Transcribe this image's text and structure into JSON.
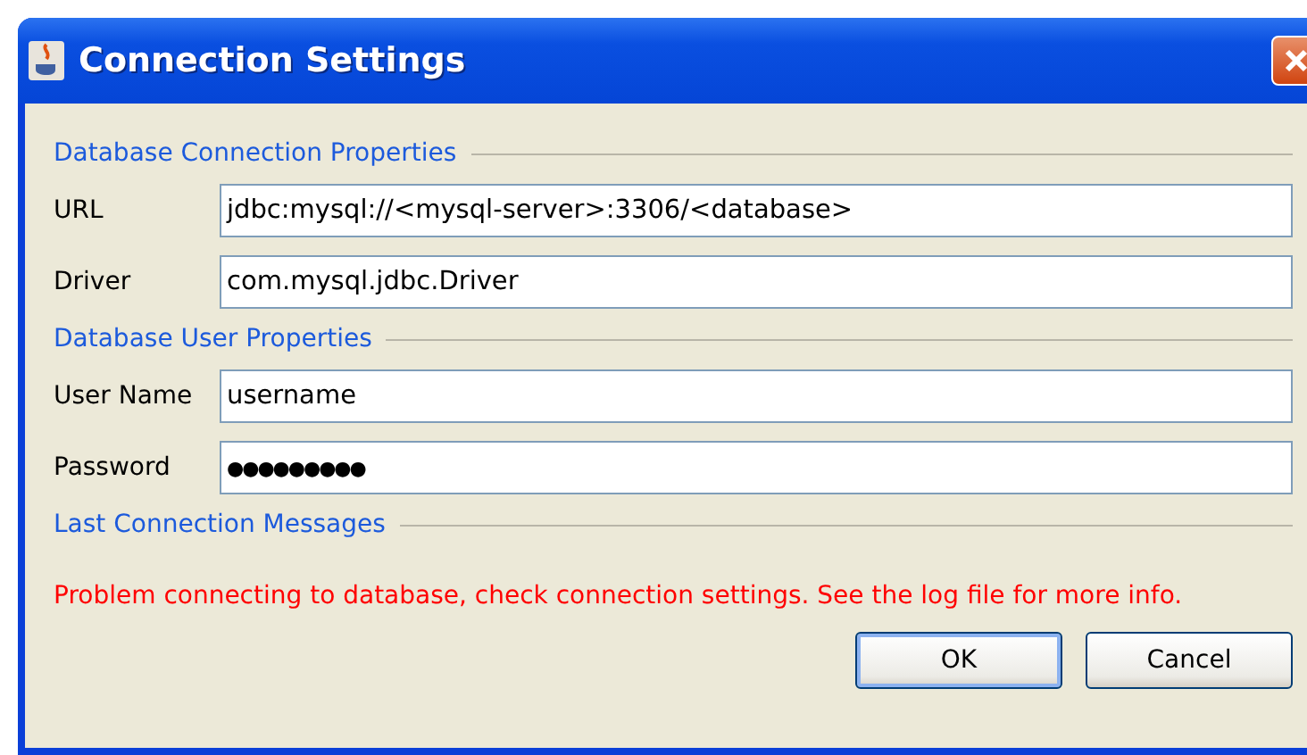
{
  "window": {
    "title": "Connection Settings"
  },
  "sections": [
    {
      "title": "Database Connection Properties",
      "fields": [
        {
          "label": "URL",
          "value": "jdbc:mysql://<mysql-server>:3306/<database>"
        },
        {
          "label": "Driver",
          "value": "com.mysql.jdbc.Driver"
        }
      ]
    },
    {
      "title": "Database User Properties",
      "fields": [
        {
          "label": "User Name",
          "value": "username"
        },
        {
          "label": "Password",
          "value": "●●●●●●●●●"
        }
      ]
    },
    {
      "title": "Last Connection Messages",
      "message": "Problem connecting to database, check connection settings. See the log file for more info."
    }
  ],
  "buttons": [
    {
      "label": "OK",
      "default": true
    },
    {
      "label": "Cancel",
      "default": false
    }
  ]
}
